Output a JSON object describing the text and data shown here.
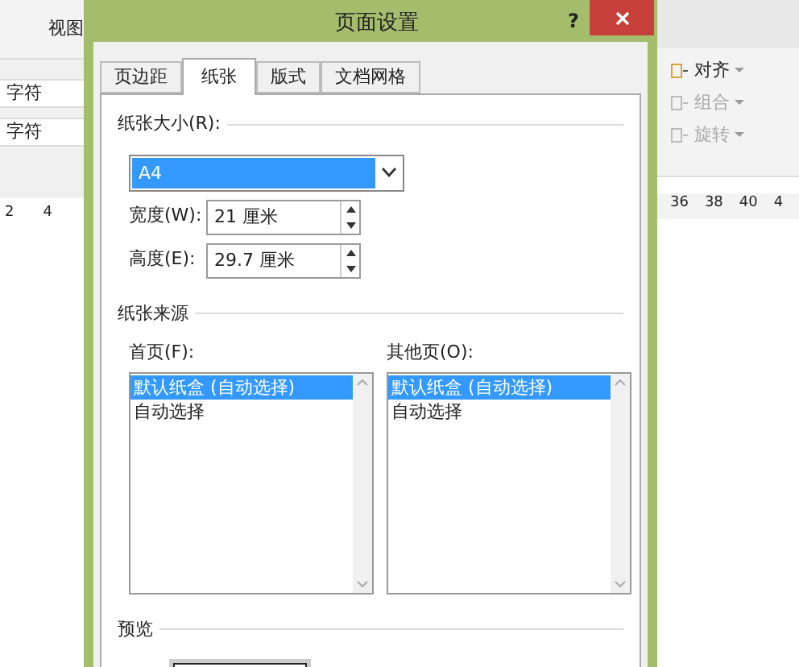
{
  "background_app": {
    "left_tab": "视图",
    "left_fields": [
      "字符",
      "字符"
    ],
    "left_ruler": [
      "2",
      "4"
    ],
    "right_commands": [
      {
        "label": "对齐",
        "disabled": false
      },
      {
        "label": "组合",
        "disabled": true
      },
      {
        "label": "旋转",
        "disabled": true
      }
    ],
    "right_ruler": [
      "36",
      "38",
      "40",
      "4"
    ]
  },
  "dialog": {
    "title": "页面设置",
    "help": "?",
    "tabs": [
      {
        "label": "页边距",
        "selected": false
      },
      {
        "label": "纸张",
        "selected": true
      },
      {
        "label": "版式",
        "selected": false
      },
      {
        "label": "文档网格",
        "selected": false
      }
    ],
    "paper_size": {
      "label": "纸张大小(R):",
      "value": "A4",
      "width": {
        "label": "宽度(W):",
        "value": "21 厘米"
      },
      "height": {
        "label": "高度(E):",
        "value": "29.7 厘米"
      }
    },
    "paper_source": {
      "label": "纸张来源",
      "lists": [
        {
          "label": "首页(F):",
          "items": [
            {
              "text": "默认纸盒 (自动选择)",
              "selected": true
            },
            {
              "text": "自动选择",
              "selected": false
            }
          ]
        },
        {
          "label": "其他页(O):",
          "items": [
            {
              "text": "默认纸盒 (自动选择)",
              "selected": true
            },
            {
              "text": "自动选择",
              "selected": false
            }
          ]
        }
      ]
    },
    "preview": {
      "label": "预览"
    }
  }
}
